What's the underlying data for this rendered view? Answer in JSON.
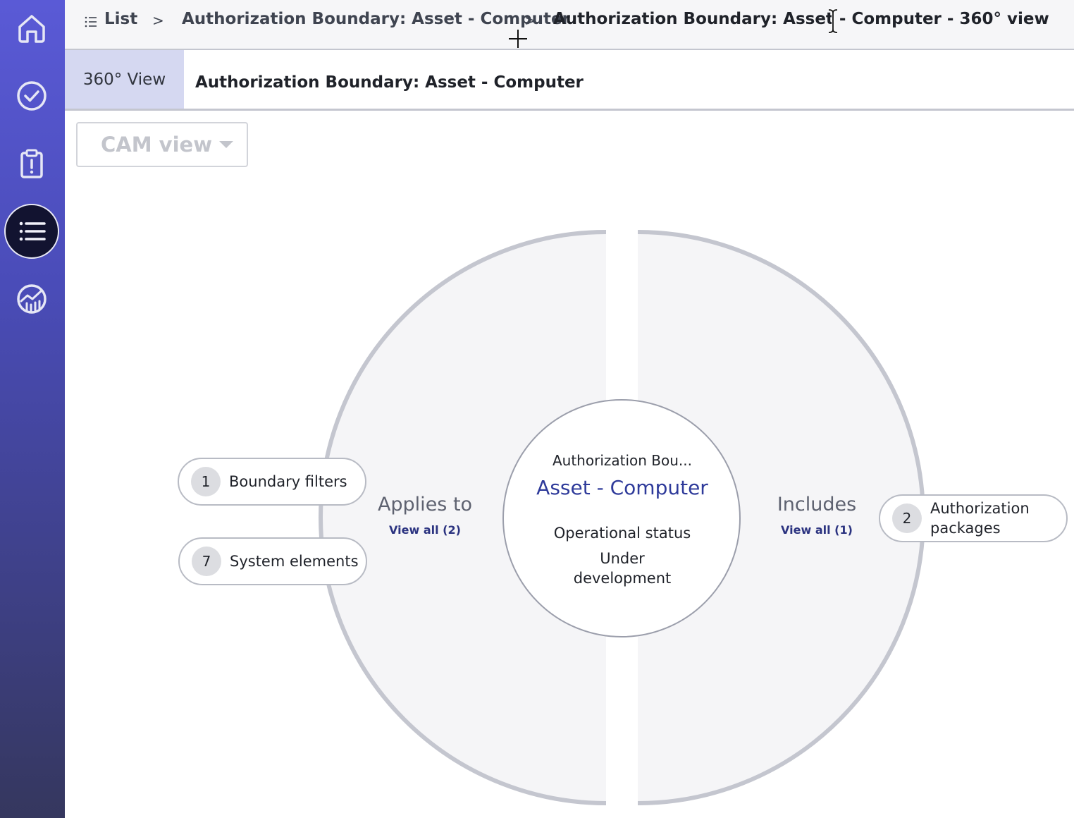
{
  "sidebar": {
    "items": [
      {
        "name": "home",
        "icon": "home-icon",
        "active": false
      },
      {
        "name": "tasks",
        "icon": "check-circle-icon",
        "active": false
      },
      {
        "name": "issues",
        "icon": "clipboard-alert-icon",
        "active": false
      },
      {
        "name": "list",
        "icon": "list-icon",
        "active": true
      },
      {
        "name": "analytics",
        "icon": "chart-icon",
        "active": false
      }
    ]
  },
  "breadcrumb": {
    "list_label": "List",
    "items": [
      "Authorization Boundary: Asset - Computer",
      "Authorization Boundary: Asset - Computer - 360° view"
    ],
    "separator": ">"
  },
  "subheader": {
    "tab_label": "360° View",
    "title": "Authorization Boundary: Asset - Computer"
  },
  "view_selector": {
    "value": "CAM view"
  },
  "diagram": {
    "center": {
      "type_label": "Authorization Bou...",
      "name": "Asset - Computer",
      "status_label": "Operational status",
      "status_value": "Under development"
    },
    "left": {
      "title": "Applies to",
      "view_all": "View all (2)",
      "pills": [
        {
          "count": "1",
          "label": "Boundary filters"
        },
        {
          "count": "7",
          "label": "System elements"
        }
      ]
    },
    "right": {
      "title": "Includes",
      "view_all": "View all (1)",
      "pills": [
        {
          "count": "2",
          "label": "Authorization packages"
        }
      ]
    }
  },
  "colors": {
    "accent": "#2e3a9a",
    "sidebar_top": "#5a5ad6",
    "sidebar_bottom": "#35375e",
    "tab_active_bg": "#d5d8f1"
  }
}
